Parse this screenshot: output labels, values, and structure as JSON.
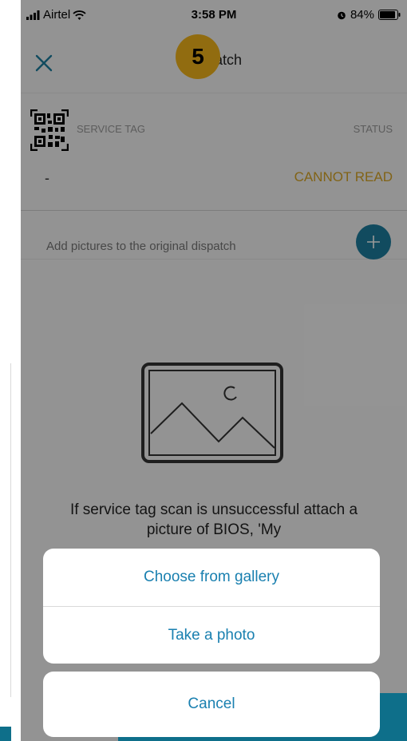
{
  "status_bar": {
    "carrier": "Airtel",
    "time": "3:58 PM",
    "battery": "84%"
  },
  "header": {
    "title": "Dispatch",
    "close_icon": "close-icon"
  },
  "service_card": {
    "service_tag_label": "SERVICE TAG",
    "status_label": "STATUS",
    "service_tag_value": "-",
    "status_value": "CANNOT READ",
    "status_color": "#d8a526",
    "step_badge": "5",
    "badge_color": "#f2b51b"
  },
  "add_pictures": {
    "label": "Add pictures to the original dispatch",
    "button_icon": "plus-icon",
    "accent": "#1d7d9e"
  },
  "empty_state": {
    "icon": "image-placeholder-icon",
    "text": "If service tag scan is unsuccessful attach a picture of BIOS, 'My"
  },
  "action_sheet": {
    "options": [
      {
        "label": "Choose from gallery"
      },
      {
        "label": "Take a photo"
      }
    ],
    "cancel_label": "Cancel",
    "text_color": "#1a80b0"
  }
}
